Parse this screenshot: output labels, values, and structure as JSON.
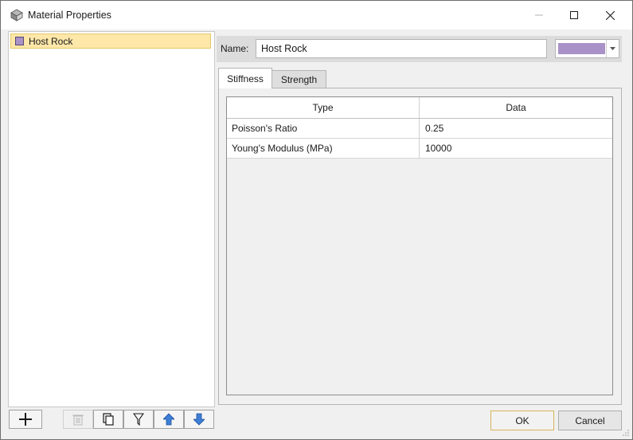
{
  "window": {
    "title": "Material Properties",
    "title_icon": "material-properties-icon"
  },
  "material_list": {
    "items": [
      {
        "label": "Host Rock",
        "color": "#a992c8",
        "selected": true
      }
    ]
  },
  "toolbar": {
    "buttons": [
      "add-icon",
      "delete-icon",
      "copy-icon",
      "filter-icon",
      "move-up-icon",
      "move-down-icon"
    ]
  },
  "properties": {
    "name_label": "Name:",
    "name_value": "Host Rock",
    "color": "#a992c8"
  },
  "tabs": [
    {
      "label": "Stiffness",
      "active": true
    },
    {
      "label": "Strength",
      "active": false
    }
  ],
  "grid": {
    "columns": [
      "Type",
      "Data"
    ],
    "rows": [
      {
        "type": "Poisson's Ratio",
        "data": "0.25"
      },
      {
        "type": "Young's Modulus (MPa)",
        "data": "10000"
      }
    ]
  },
  "dialog_buttons": {
    "ok_label": "OK",
    "cancel_label": "Cancel"
  },
  "colors": {
    "selection_bg": "#fde7a9",
    "accent_blue": "#3d7fd6"
  }
}
